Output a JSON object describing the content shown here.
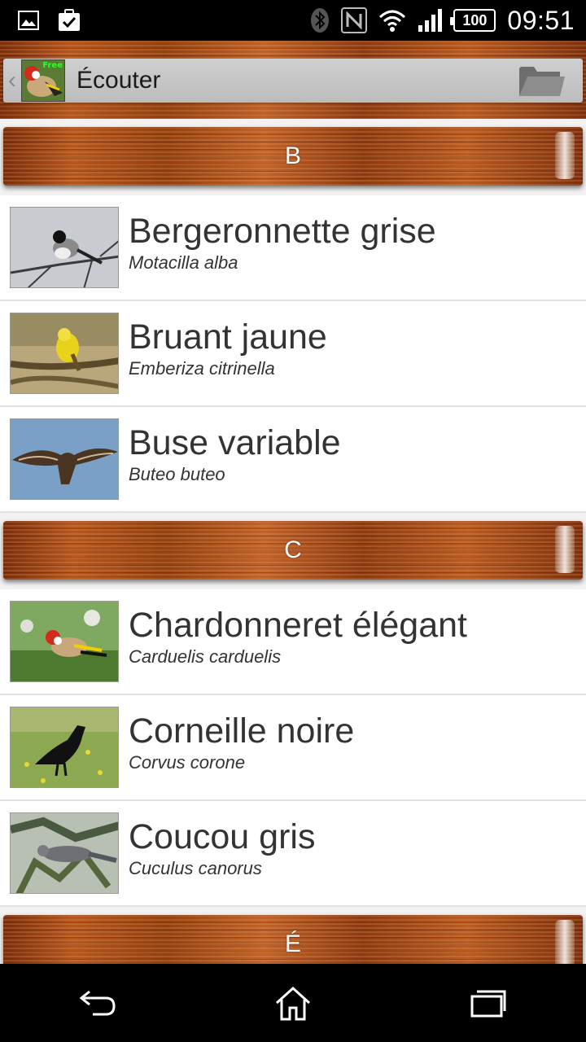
{
  "status_bar": {
    "battery": "100",
    "time": "09:51",
    "icons": [
      "image-icon",
      "clipboard-check-icon",
      "bluetooth-icon",
      "nfc-icon",
      "wifi-icon",
      "signal-icon",
      "battery-icon"
    ]
  },
  "action_bar": {
    "title": "Écouter",
    "app_icon_badge": "Free",
    "icons": [
      "back-chevron-icon",
      "folder-icon"
    ]
  },
  "list": {
    "sections": [
      {
        "letter": "B",
        "items": [
          {
            "name": "Bergeronnette grise",
            "latin": "Motacilla alba",
            "photo": "wagtail-photo"
          },
          {
            "name": "Bruant jaune",
            "latin": "Emberiza citrinella",
            "photo": "yellowhammer-photo"
          },
          {
            "name": "Buse variable",
            "latin": "Buteo buteo",
            "photo": "buzzard-photo"
          }
        ]
      },
      {
        "letter": "C",
        "items": [
          {
            "name": "Chardonneret élégant",
            "latin": "Carduelis carduelis",
            "photo": "goldfinch-photo"
          },
          {
            "name": "Corneille noire",
            "latin": "Corvus corone",
            "photo": "crow-photo"
          },
          {
            "name": "Coucou gris",
            "latin": "Cuculus canorus",
            "photo": "cuckoo-photo"
          }
        ]
      },
      {
        "letter": "É",
        "items": []
      }
    ]
  },
  "nav_bar": {
    "icons": [
      "back-icon",
      "home-icon",
      "recent-apps-icon"
    ]
  },
  "colors": {
    "wood": "#a0461a",
    "status_bar_bg": "#000000",
    "action_bar_inner": "#c4c4c4",
    "row_bg": "#ffffff",
    "text": "#333333"
  }
}
